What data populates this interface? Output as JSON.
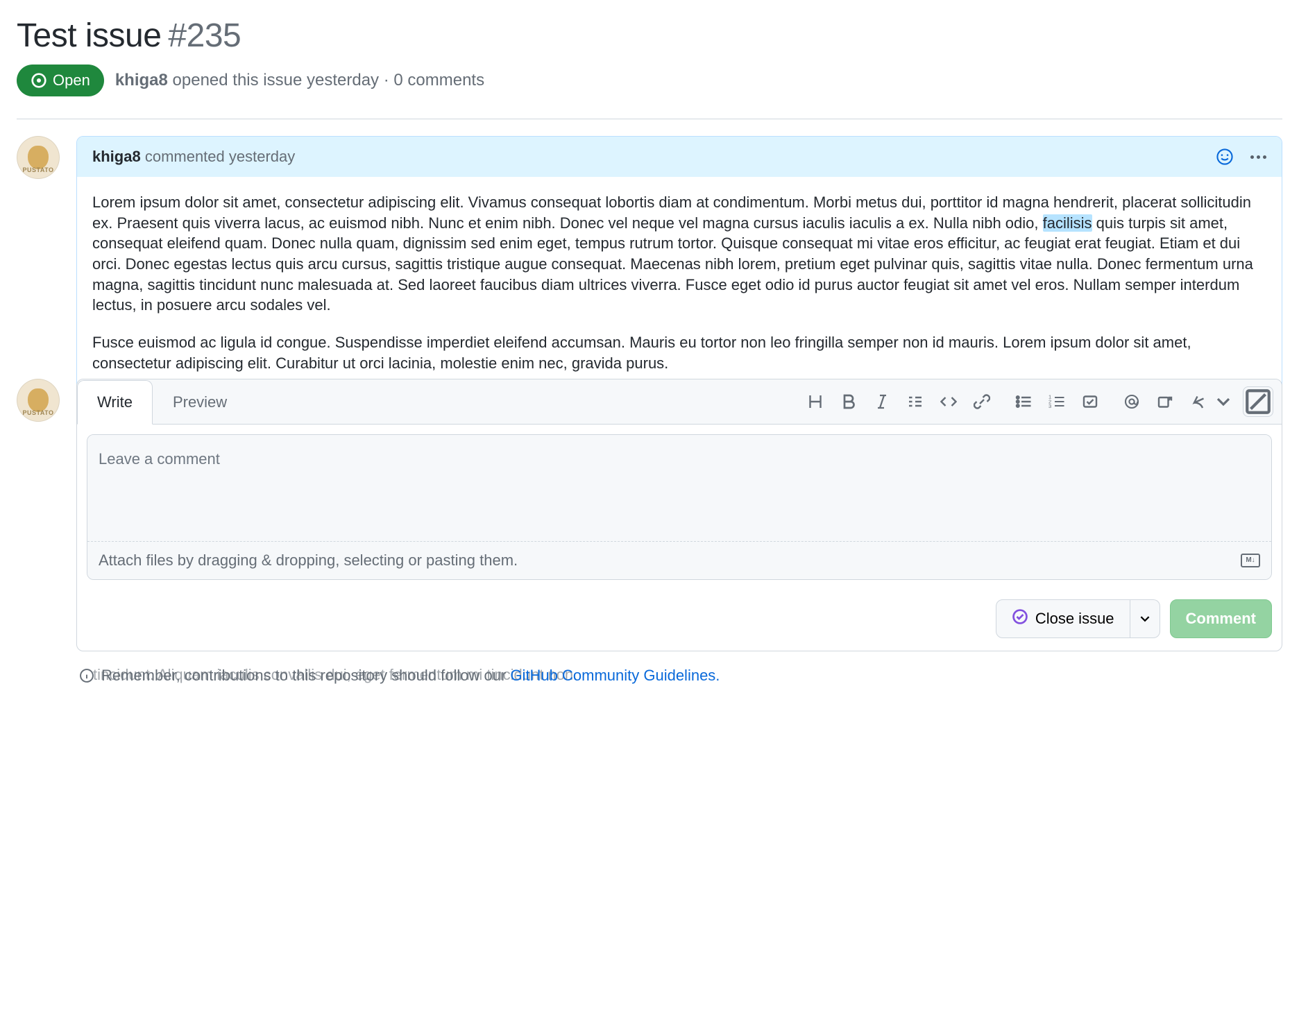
{
  "issue": {
    "title": "Test issue",
    "number": "#235",
    "state": "Open",
    "author": "khiga8",
    "opened": "opened this issue yesterday",
    "sep": "·",
    "comments": "0 comments"
  },
  "comment": {
    "author": "khiga8",
    "when": "commented yesterday",
    "para1_a": "Lorem ipsum dolor sit amet, consectetur adipiscing elit. Vivamus consequat lobortis diam at condimentum. Morbi metus dui, porttitor id magna hendrerit, placerat sollicitudin ex. Praesent quis viverra lacus, ac euismod nibh. Nunc et enim nibh. Donec vel neque vel magna cursus iaculis iaculis a ex. Nulla nibh odio, ",
    "para1_hl": "facilisis",
    "para1_b": " quis turpis sit amet, consequat eleifend quam. Donec nulla quam, dignissim sed enim eget, tempus rutrum tortor. Quisque consequat mi vitae eros efficitur, ac feugiat erat feugiat. Etiam et dui orci. Donec egestas lectus quis arcu cursus, sagittis tristique augue consequat. Maecenas nibh lorem, pretium eget pulvinar quis, sagittis vitae nulla. Donec fermentum urna magna, sagittis tincidunt nunc malesuada at. Sed laoreet faucibus diam ultrices viverra. Fusce eget odio id purus auctor feugiat sit amet vel eros. Nullam semper interdum lectus, in posuere arcu sodales vel.",
    "para2": "Fusce euismod ac ligula id congue. Suspendisse imperdiet eleifend accumsan. Mauris eu tortor non leo fringilla semper non id mauris. Lorem ipsum dolor sit amet, consectetur adipiscing elit. Curabitur ut orci lacinia, molestie enim nec, gravida purus."
  },
  "compose": {
    "tabs": {
      "write": "Write",
      "preview": "Preview"
    },
    "placeholder": "Leave a comment",
    "attach": "Attach files by dragging & dropping, selecting or pasting them.",
    "close": "Close issue",
    "comment": "Comment"
  },
  "footer": {
    "ghost": "tincidunt. Aliquam iaculis convallis dui, eget fermentum mi tincidunt non.",
    "remember_a": "Remember, contributions to this repository should follow our ",
    "remember_link": "GitHub Community Guidelines.",
    "avatar_tag": "PUSTATO",
    "md": "M↓"
  }
}
